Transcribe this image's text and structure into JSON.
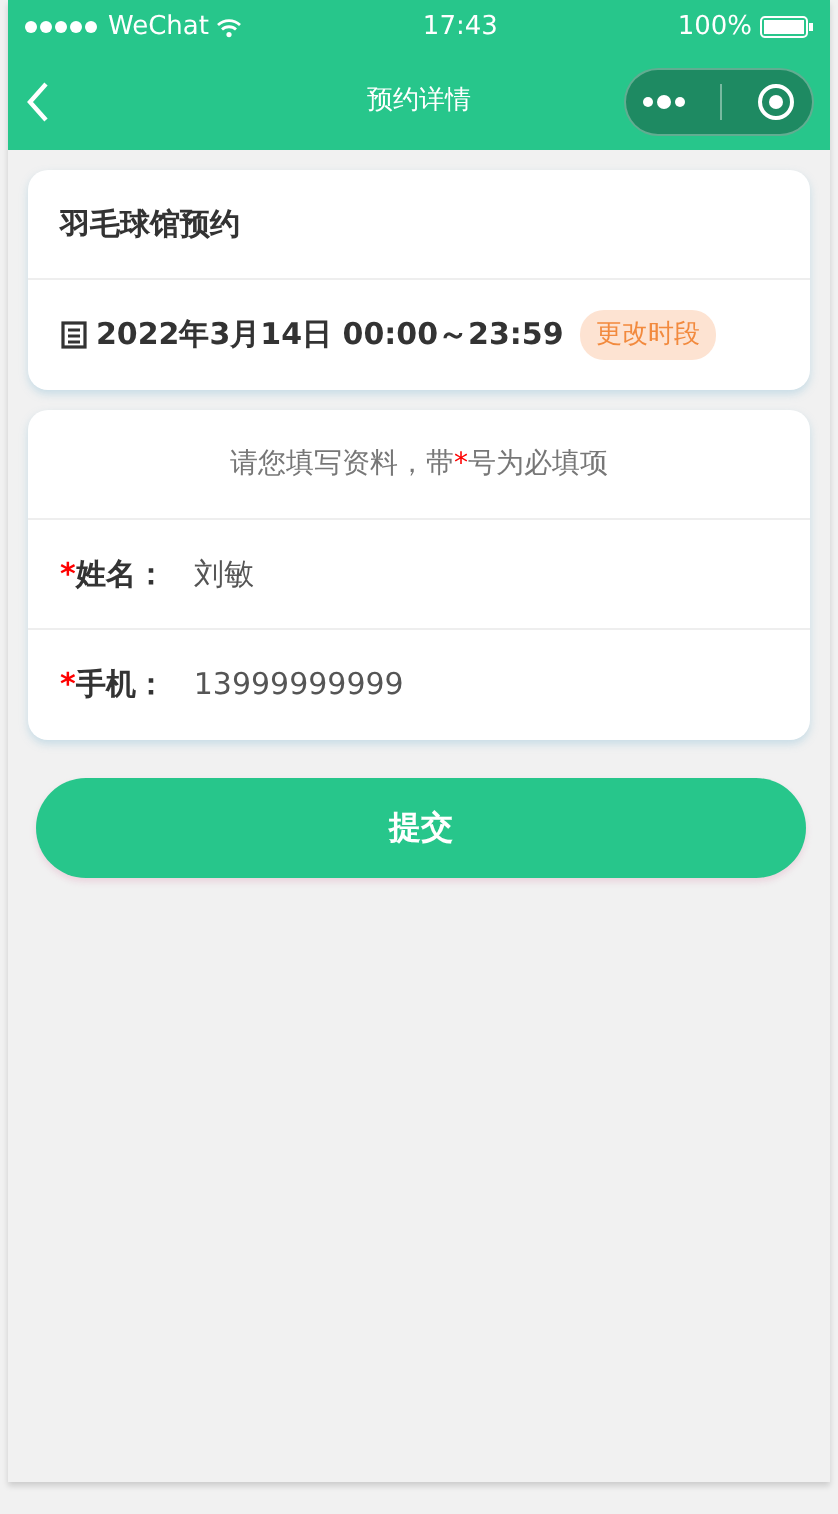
{
  "status_bar": {
    "carrier": "WeChat",
    "time": "17:43",
    "battery": "100%"
  },
  "nav": {
    "title": "预约详情"
  },
  "booking": {
    "title": "羽毛球馆预约",
    "datetime": "2022年3月14日 00:00～23:59",
    "change_button": "更改时段"
  },
  "form": {
    "notice": {
      "before": "请您填写资料，带",
      "mark": "*",
      "after": "号为必填项"
    },
    "fields": [
      {
        "required_mark": "*",
        "label": "姓名：",
        "value": "刘敏"
      },
      {
        "required_mark": "*",
        "label": "手机：",
        "value": "13999999999"
      }
    ]
  },
  "submit_button": "提交"
}
